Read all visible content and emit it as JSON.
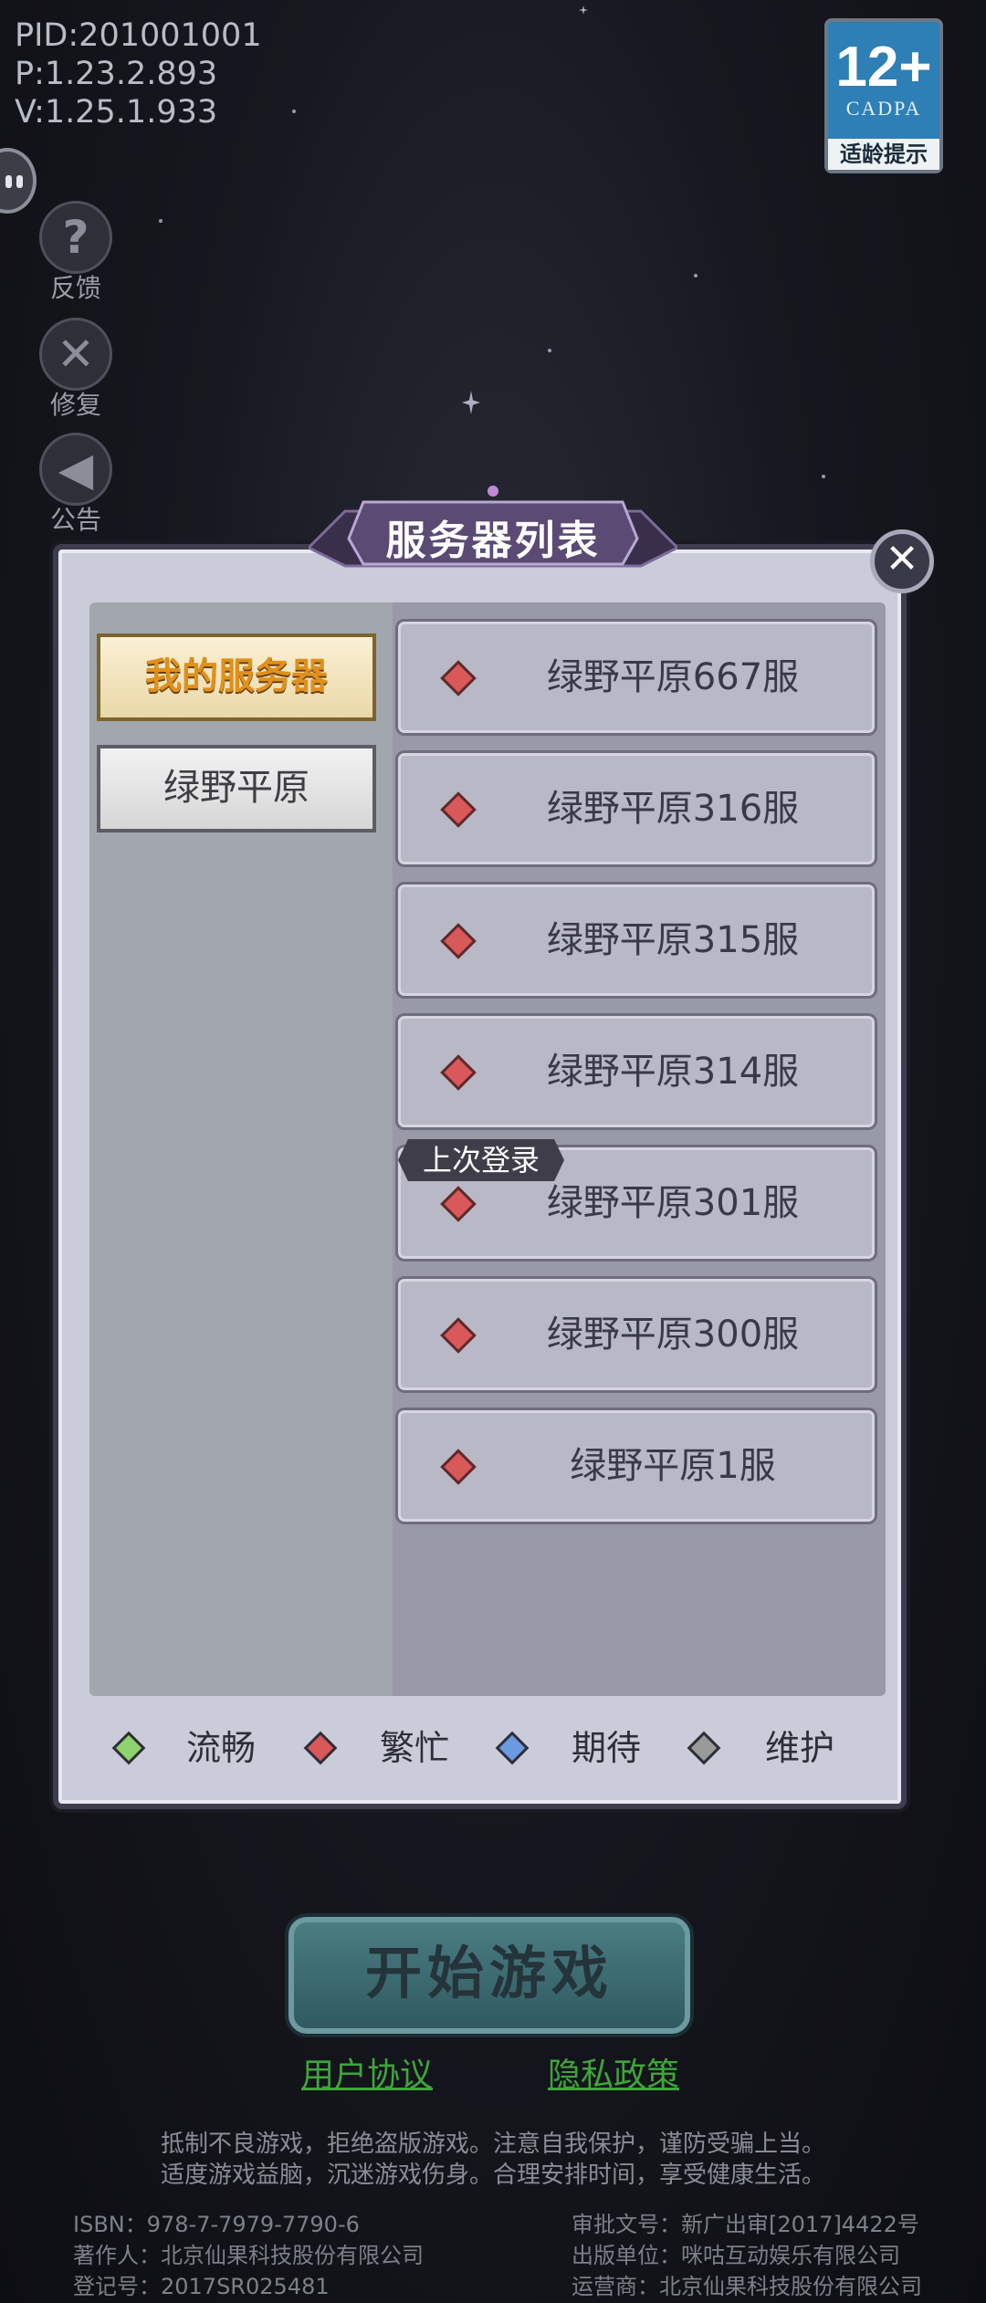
{
  "version": {
    "pid": "PID:201001001",
    "p": "P:1.23.2.893",
    "v": "V:1.25.1.933"
  },
  "age_rating": {
    "number": "12+",
    "org": "CADPA",
    "tip": "适龄提示"
  },
  "tools": [
    {
      "label": "反馈",
      "icon": "question-icon"
    },
    {
      "label": "修复",
      "icon": "wrench-icon"
    },
    {
      "label": "公告",
      "icon": "megaphone-icon"
    }
  ],
  "dialog": {
    "title": "服务器列表",
    "categories": [
      {
        "label": "我的服务器",
        "selected": true
      },
      {
        "label": "绿野平原",
        "selected": false
      }
    ],
    "servers": [
      {
        "name": "绿野平原667服",
        "status": "busy"
      },
      {
        "name": "绿野平原316服",
        "status": "busy"
      },
      {
        "name": "绿野平原315服",
        "status": "busy"
      },
      {
        "name": "绿野平原314服",
        "status": "busy"
      },
      {
        "name": "绿野平原301服",
        "status": "busy"
      },
      {
        "name": "绿野平原300服",
        "status": "busy"
      },
      {
        "name": "绿野平原1服",
        "status": "busy"
      }
    ],
    "last_login_label": "上次登录",
    "legend": [
      {
        "label": "流畅",
        "color": "#8fd36e"
      },
      {
        "label": "繁忙",
        "color": "#d9585a"
      },
      {
        "label": "期待",
        "color": "#6b9ae0"
      },
      {
        "label": "维护",
        "color": "#9a9a9a"
      }
    ]
  },
  "start_button": "开始游戏",
  "links": {
    "user_agreement": "用户协议",
    "privacy_policy": "隐私政策"
  },
  "notice": {
    "line1": "抵制不良游戏，拒绝盗版游戏。注意自我保护，谨防受骗上当。",
    "line2": "适度游戏益脑，沉迷游戏伤身。合理安排时间，享受健康生活。"
  },
  "credits": {
    "isbn": "ISBN：978-7-7979-7790-6",
    "author": "著作人：北京仙果科技股份有限公司",
    "reg": "登记号：2017SR025481",
    "approval": "审批文号：新广出审[2017]4422号",
    "publisher": "出版单位：咪咕互动娱乐有限公司",
    "operator": "运营商：北京仙果科技股份有限公司"
  }
}
